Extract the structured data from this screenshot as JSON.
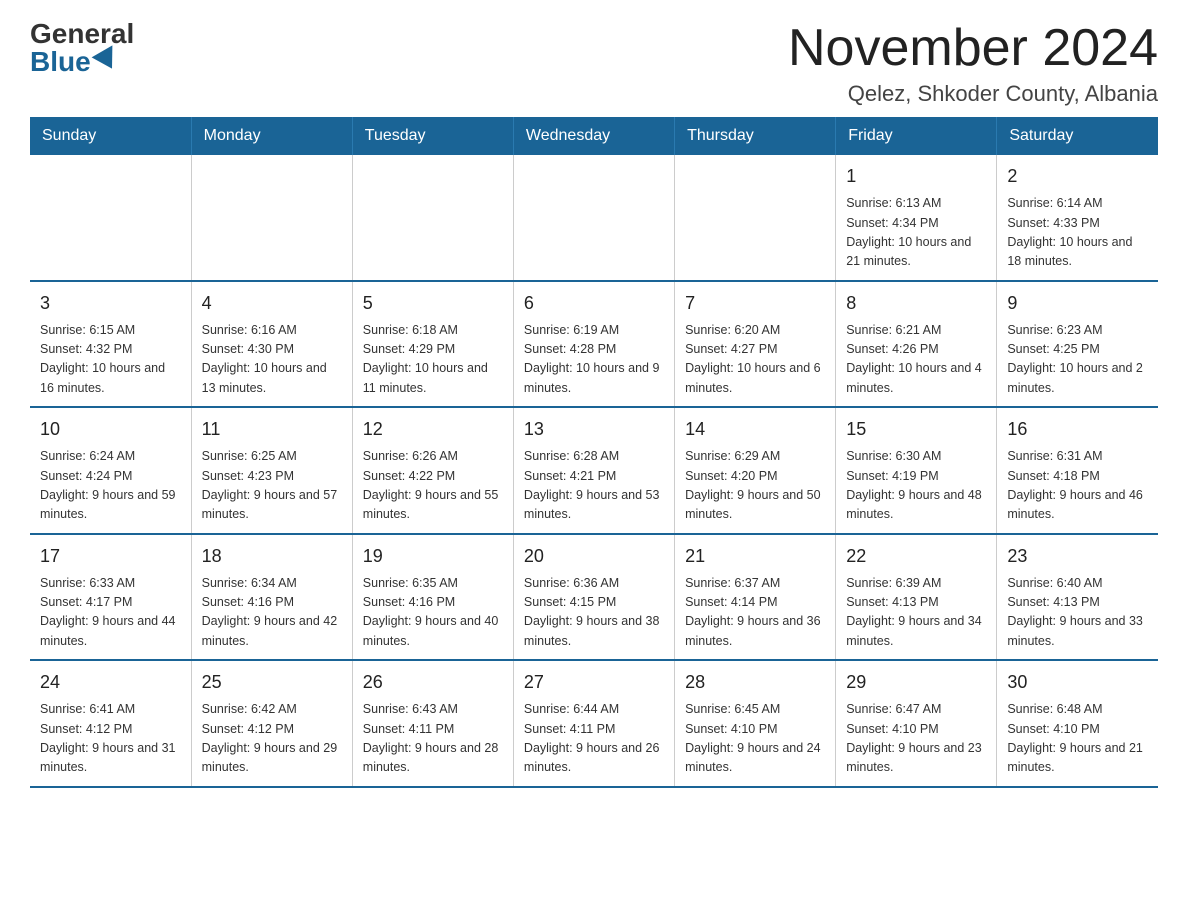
{
  "header": {
    "logo_general": "General",
    "logo_blue": "Blue",
    "title": "November 2024",
    "subtitle": "Qelez, Shkoder County, Albania"
  },
  "days_of_week": [
    "Sunday",
    "Monday",
    "Tuesday",
    "Wednesday",
    "Thursday",
    "Friday",
    "Saturday"
  ],
  "weeks": [
    [
      {
        "day": "",
        "info": ""
      },
      {
        "day": "",
        "info": ""
      },
      {
        "day": "",
        "info": ""
      },
      {
        "day": "",
        "info": ""
      },
      {
        "day": "",
        "info": ""
      },
      {
        "day": "1",
        "info": "Sunrise: 6:13 AM\nSunset: 4:34 PM\nDaylight: 10 hours and 21 minutes."
      },
      {
        "day": "2",
        "info": "Sunrise: 6:14 AM\nSunset: 4:33 PM\nDaylight: 10 hours and 18 minutes."
      }
    ],
    [
      {
        "day": "3",
        "info": "Sunrise: 6:15 AM\nSunset: 4:32 PM\nDaylight: 10 hours and 16 minutes."
      },
      {
        "day": "4",
        "info": "Sunrise: 6:16 AM\nSunset: 4:30 PM\nDaylight: 10 hours and 13 minutes."
      },
      {
        "day": "5",
        "info": "Sunrise: 6:18 AM\nSunset: 4:29 PM\nDaylight: 10 hours and 11 minutes."
      },
      {
        "day": "6",
        "info": "Sunrise: 6:19 AM\nSunset: 4:28 PM\nDaylight: 10 hours and 9 minutes."
      },
      {
        "day": "7",
        "info": "Sunrise: 6:20 AM\nSunset: 4:27 PM\nDaylight: 10 hours and 6 minutes."
      },
      {
        "day": "8",
        "info": "Sunrise: 6:21 AM\nSunset: 4:26 PM\nDaylight: 10 hours and 4 minutes."
      },
      {
        "day": "9",
        "info": "Sunrise: 6:23 AM\nSunset: 4:25 PM\nDaylight: 10 hours and 2 minutes."
      }
    ],
    [
      {
        "day": "10",
        "info": "Sunrise: 6:24 AM\nSunset: 4:24 PM\nDaylight: 9 hours and 59 minutes."
      },
      {
        "day": "11",
        "info": "Sunrise: 6:25 AM\nSunset: 4:23 PM\nDaylight: 9 hours and 57 minutes."
      },
      {
        "day": "12",
        "info": "Sunrise: 6:26 AM\nSunset: 4:22 PM\nDaylight: 9 hours and 55 minutes."
      },
      {
        "day": "13",
        "info": "Sunrise: 6:28 AM\nSunset: 4:21 PM\nDaylight: 9 hours and 53 minutes."
      },
      {
        "day": "14",
        "info": "Sunrise: 6:29 AM\nSunset: 4:20 PM\nDaylight: 9 hours and 50 minutes."
      },
      {
        "day": "15",
        "info": "Sunrise: 6:30 AM\nSunset: 4:19 PM\nDaylight: 9 hours and 48 minutes."
      },
      {
        "day": "16",
        "info": "Sunrise: 6:31 AM\nSunset: 4:18 PM\nDaylight: 9 hours and 46 minutes."
      }
    ],
    [
      {
        "day": "17",
        "info": "Sunrise: 6:33 AM\nSunset: 4:17 PM\nDaylight: 9 hours and 44 minutes."
      },
      {
        "day": "18",
        "info": "Sunrise: 6:34 AM\nSunset: 4:16 PM\nDaylight: 9 hours and 42 minutes."
      },
      {
        "day": "19",
        "info": "Sunrise: 6:35 AM\nSunset: 4:16 PM\nDaylight: 9 hours and 40 minutes."
      },
      {
        "day": "20",
        "info": "Sunrise: 6:36 AM\nSunset: 4:15 PM\nDaylight: 9 hours and 38 minutes."
      },
      {
        "day": "21",
        "info": "Sunrise: 6:37 AM\nSunset: 4:14 PM\nDaylight: 9 hours and 36 minutes."
      },
      {
        "day": "22",
        "info": "Sunrise: 6:39 AM\nSunset: 4:13 PM\nDaylight: 9 hours and 34 minutes."
      },
      {
        "day": "23",
        "info": "Sunrise: 6:40 AM\nSunset: 4:13 PM\nDaylight: 9 hours and 33 minutes."
      }
    ],
    [
      {
        "day": "24",
        "info": "Sunrise: 6:41 AM\nSunset: 4:12 PM\nDaylight: 9 hours and 31 minutes."
      },
      {
        "day": "25",
        "info": "Sunrise: 6:42 AM\nSunset: 4:12 PM\nDaylight: 9 hours and 29 minutes."
      },
      {
        "day": "26",
        "info": "Sunrise: 6:43 AM\nSunset: 4:11 PM\nDaylight: 9 hours and 28 minutes."
      },
      {
        "day": "27",
        "info": "Sunrise: 6:44 AM\nSunset: 4:11 PM\nDaylight: 9 hours and 26 minutes."
      },
      {
        "day": "28",
        "info": "Sunrise: 6:45 AM\nSunset: 4:10 PM\nDaylight: 9 hours and 24 minutes."
      },
      {
        "day": "29",
        "info": "Sunrise: 6:47 AM\nSunset: 4:10 PM\nDaylight: 9 hours and 23 minutes."
      },
      {
        "day": "30",
        "info": "Sunrise: 6:48 AM\nSunset: 4:10 PM\nDaylight: 9 hours and 21 minutes."
      }
    ]
  ]
}
